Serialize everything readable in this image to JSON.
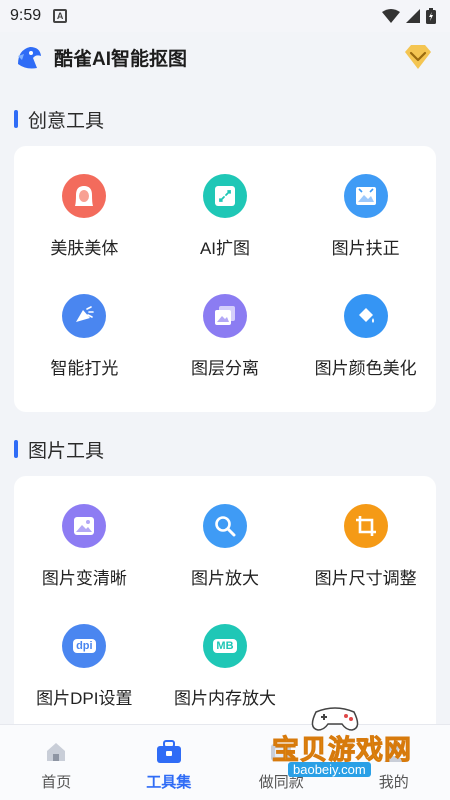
{
  "status_bar": {
    "time": "9:59",
    "notification_letter": "A"
  },
  "header": {
    "title": "酷雀AI智能抠图"
  },
  "sections": [
    {
      "title": "创意工具",
      "tools": [
        {
          "label": "美肤美体",
          "icon": "face-icon",
          "color": "#f36b5c"
        },
        {
          "label": "AI扩图",
          "icon": "expand-icon",
          "color": "#1fc7b6"
        },
        {
          "label": "图片扶正",
          "icon": "straighten-icon",
          "color": "#3f9bf5"
        },
        {
          "label": "智能打光",
          "icon": "light-icon",
          "color": "#4a86f0"
        },
        {
          "label": "图层分离",
          "icon": "layers-icon",
          "color": "#8b7cf2"
        },
        {
          "label": "图片颜色美化",
          "icon": "paint-bucket-icon",
          "color": "#3595f4"
        }
      ]
    },
    {
      "title": "图片工具",
      "tools": [
        {
          "label": "图片变清晰",
          "icon": "image-icon",
          "color": "#8d7cf3"
        },
        {
          "label": "图片放大",
          "icon": "magnifier-icon",
          "color": "#3f9bf5"
        },
        {
          "label": "图片尺寸调整",
          "icon": "crop-icon",
          "color": "#f59a16"
        },
        {
          "label": "图片DPI设置",
          "icon": "dpi-icon",
          "icon_text": "dpi",
          "color": "#4a86f0"
        },
        {
          "label": "图片内存放大",
          "icon": "mb-icon",
          "icon_text": "MB",
          "color": "#1fc7b6"
        }
      ]
    }
  ],
  "tabbar": [
    {
      "label": "首页",
      "icon": "home-icon",
      "active": false
    },
    {
      "label": "工具集",
      "icon": "toolbox-icon",
      "active": true
    },
    {
      "label": "做同款",
      "icon": "template-icon",
      "active": false
    },
    {
      "label": "我的",
      "icon": "profile-icon",
      "active": false
    }
  ],
  "watermark": {
    "title": "宝贝游戏网",
    "url": "baobeiy.com"
  },
  "colors": {
    "accent": "#2f6cf6",
    "background": "#f2f4f8"
  }
}
